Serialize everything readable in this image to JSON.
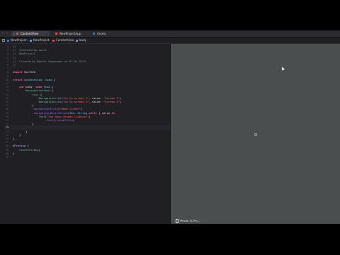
{
  "tabbar": {
    "tabs": [
      {
        "label": "ContentView",
        "active": true,
        "icon": "swift-icon"
      },
      {
        "label": "NewProjectApp",
        "active": false,
        "icon": "swift-icon"
      },
      {
        "label": "Assets",
        "active": false,
        "icon": "assets-icon"
      }
    ]
  },
  "breadcrumb": {
    "project": "NewProject",
    "group": "NewProject",
    "file": "ContentView",
    "symbol": "body"
  },
  "editor": {
    "current_line": 23,
    "lines": [
      {
        "n": "1",
        "parts": [
          {
            "c": "cmt",
            "t": "//"
          }
        ]
      },
      {
        "n": "2",
        "parts": [
          {
            "c": "cmt",
            "t": "//  ContentView.swift"
          }
        ]
      },
      {
        "n": "3",
        "parts": [
          {
            "c": "cmt",
            "t": "//  NewProject"
          }
        ]
      },
      {
        "n": "4",
        "parts": [
          {
            "c": "cmt",
            "t": "//"
          }
        ]
      },
      {
        "n": "5",
        "parts": [
          {
            "c": "cmt",
            "t": "//  Created by Wouter Koppenaar on 07.01.2023."
          }
        ]
      },
      {
        "n": "6",
        "parts": [
          {
            "c": "cmt",
            "t": "//"
          }
        ]
      },
      {
        "n": "7",
        "parts": []
      },
      {
        "n": "8",
        "parts": [
          {
            "c": "kw",
            "t": "import"
          },
          {
            "c": "",
            "t": " SwiftUI"
          }
        ]
      },
      {
        "n": "9",
        "parts": []
      },
      {
        "n": "10",
        "parts": [
          {
            "c": "kw",
            "t": "struct"
          },
          {
            "c": "",
            "t": " "
          },
          {
            "c": "type",
            "t": "ContentView"
          },
          {
            "c": "",
            "t": ": "
          },
          {
            "c": "type",
            "t": "View"
          },
          {
            "c": "",
            "t": " {"
          }
        ]
      },
      {
        "n": "11",
        "parts": []
      },
      {
        "n": "12",
        "parts": [
          {
            "c": "",
            "t": "    "
          },
          {
            "c": "kw",
            "t": "var"
          },
          {
            "c": "",
            "t": " body: "
          },
          {
            "c": "kw",
            "t": "some"
          },
          {
            "c": "",
            "t": " "
          },
          {
            "c": "type",
            "t": "View"
          },
          {
            "c": "",
            "t": " {"
          }
        ]
      },
      {
        "n": "13",
        "parts": [
          {
            "c": "",
            "t": "        "
          },
          {
            "c": "fn",
            "t": "NavigationStack"
          },
          {
            "c": "",
            "t": " {"
          }
        ]
      },
      {
        "n": "14",
        "parts": [
          {
            "c": "",
            "t": "            "
          },
          {
            "c": "fn",
            "t": "List"
          },
          {
            "c": "",
            "t": " {"
          }
        ]
      },
      {
        "n": "15",
        "parts": [
          {
            "c": "",
            "t": "                "
          },
          {
            "c": "fn",
            "t": "NavigationLink"
          },
          {
            "c": "",
            "t": "("
          },
          {
            "c": "str",
            "t": "\"Go to screen 1\""
          },
          {
            "c": "",
            "t": ", value: "
          },
          {
            "c": "str",
            "t": "\"Screen 1\""
          },
          {
            "c": "",
            "t": ")"
          }
        ]
      },
      {
        "n": "16",
        "parts": [
          {
            "c": "",
            "t": "                "
          },
          {
            "c": "fn",
            "t": "NavigationLink"
          },
          {
            "c": "",
            "t": "("
          },
          {
            "c": "str",
            "t": "\"Go to screen 2\""
          },
          {
            "c": "",
            "t": ", value: "
          },
          {
            "c": "str",
            "t": "\"Screen 2\""
          },
          {
            "c": "",
            "t": ")"
          }
        ]
      },
      {
        "n": "17",
        "parts": [
          {
            "c": "",
            "t": "            }"
          }
        ]
      },
      {
        "n": "18",
        "parts": [
          {
            "c": "",
            "t": "            ."
          },
          {
            "c": "prop",
            "t": "navigationTitle"
          },
          {
            "c": "",
            "t": "("
          },
          {
            "c": "str",
            "t": "\"Home screen\""
          },
          {
            "c": "",
            "t": ")"
          }
        ]
      },
      {
        "n": "19",
        "parts": [
          {
            "c": "",
            "t": "            ."
          },
          {
            "c": "prop",
            "t": "navigationDestination"
          },
          {
            "c": "",
            "t": "(for: "
          },
          {
            "c": "type",
            "t": "String"
          },
          {
            "c": "",
            "t": "."
          },
          {
            "c": "kw",
            "t": "self"
          },
          {
            "c": "",
            "t": ") { value "
          },
          {
            "c": "kw",
            "t": "in"
          }
        ]
      },
      {
        "n": "20",
        "parts": [
          {
            "c": "",
            "t": "                "
          },
          {
            "c": "fn",
            "t": "Text"
          },
          {
            "c": "",
            "t": "("
          },
          {
            "c": "str",
            "t": "\"You have chosen \\(value)\""
          },
          {
            "c": "",
            "t": ")"
          }
        ]
      },
      {
        "n": "21",
        "parts": [
          {
            "c": "",
            "t": "                    ."
          },
          {
            "c": "prop",
            "t": "font"
          },
          {
            "c": "",
            "t": "(."
          },
          {
            "c": "prop",
            "t": "largeTitle"
          },
          {
            "c": "",
            "t": ")"
          }
        ]
      },
      {
        "n": "22",
        "parts": [
          {
            "c": "",
            "t": "            }"
          }
        ]
      },
      {
        "n": "23",
        "parts": []
      },
      {
        "n": "24",
        "parts": [
          {
            "c": "",
            "t": "        }"
          }
        ]
      },
      {
        "n": "25",
        "parts": [
          {
            "c": "",
            "t": "    }"
          }
        ]
      },
      {
        "n": "26",
        "parts": [
          {
            "c": "",
            "t": "}"
          }
        ]
      },
      {
        "n": "27",
        "parts": []
      },
      {
        "n": "28",
        "parts": [
          {
            "c": "attr",
            "t": "#Preview"
          },
          {
            "c": "",
            "t": " {"
          }
        ]
      },
      {
        "n": "29",
        "parts": [
          {
            "c": "",
            "t": "    "
          },
          {
            "c": "fn",
            "t": "ContentView"
          },
          {
            "c": "",
            "t": "()"
          }
        ]
      },
      {
        "n": "30",
        "parts": [
          {
            "c": "",
            "t": "}"
          }
        ]
      },
      {
        "n": "31",
        "parts": []
      }
    ]
  },
  "canvas": {
    "device_label": "iPhone 15 Pro",
    "device_chevron": "⌄"
  }
}
